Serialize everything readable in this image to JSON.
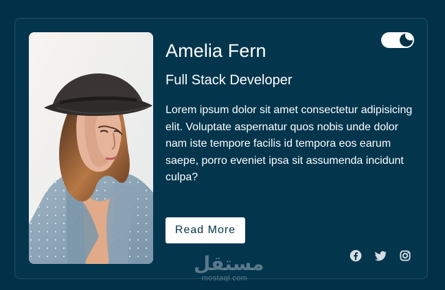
{
  "profile": {
    "name": "Amelia Fern",
    "role": "Full Stack Developer",
    "bio": "Lorem ipsum dolor sit amet consectetur adipisicing elit. Voluptate aspernatur quos nobis unde dolor nam iste tempore facilis id tempora eos earum saepe, porro eveniet ipsa sit assumenda incidunt culpa?"
  },
  "actions": {
    "read_more": "Read More"
  },
  "theme": {
    "background": "#023047",
    "card": "#03354d",
    "text": "#ffffff",
    "icon": "#d6dde2"
  },
  "icons": {
    "theme_toggle": "moon-icon",
    "social": [
      "facebook-icon",
      "twitter-icon",
      "instagram-icon"
    ]
  },
  "watermark": {
    "logo": "مستقل",
    "domain": "mostaql.com"
  }
}
